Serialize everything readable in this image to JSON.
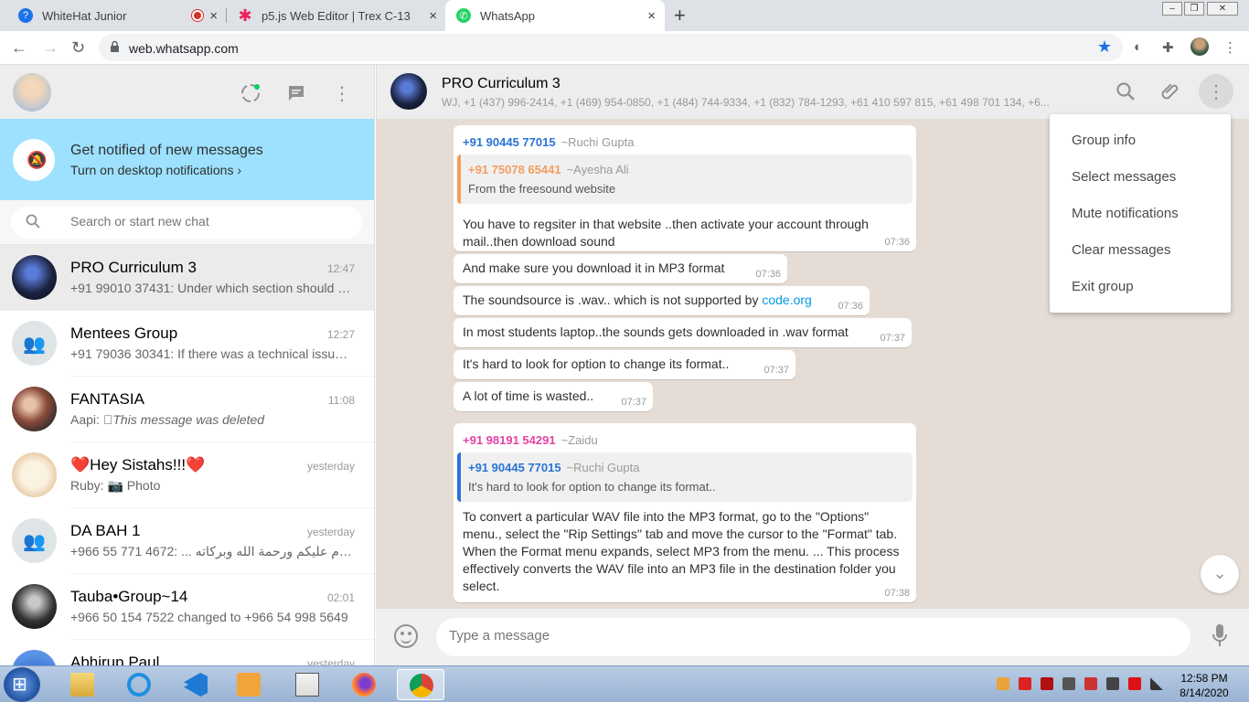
{
  "browser": {
    "tabs": [
      {
        "title": "WhiteHat Junior",
        "close": "×"
      },
      {
        "title": "p5.js Web Editor | Trex C-13",
        "close": "×"
      },
      {
        "title": "WhatsApp",
        "close": "×"
      }
    ],
    "new_tab": "+",
    "url": "web.whatsapp.com",
    "window_controls": [
      "–",
      "❐",
      "✕"
    ]
  },
  "sidebar": {
    "notification": {
      "title": "Get notified of new messages",
      "subtitle": "Turn on desktop notifications ›"
    },
    "search_placeholder": "Search or start new chat",
    "chats": [
      {
        "name": "PRO Curriculum 3",
        "time": "12:47",
        "last": "+91 99010 37431: Under which section should we ...",
        "selected": true
      },
      {
        "name": "Mentees Group",
        "time": "12:27",
        "last": "+91 79036 30341: If there was a technical issue f...",
        "selected": false
      },
      {
        "name": "FANTASIA",
        "time": "11:08",
        "last_prefix": "Aapi: ",
        "last": "This message was deleted",
        "selected": false
      },
      {
        "name": "❤️Hey Sistahs!!!❤️",
        "time": "yesterday",
        "last_prefix": "Ruby: ",
        "last": "Photo",
        "selected": false
      },
      {
        "name": "DA BAH 1",
        "time": "yesterday",
        "last": "+966 55 771 4672: ...     السلام عليكم ورحمة الله وبركاته.",
        "selected": false
      },
      {
        "name": "Tauba•Group~14",
        "time": "02:01",
        "last": "+966 50 154 7522 changed to +966 54 998 5649",
        "selected": false
      },
      {
        "name": "Abhirup Paul",
        "time": "yesterday",
        "last": "",
        "selected": false
      }
    ]
  },
  "conversation": {
    "title": "PRO Curriculum 3",
    "members": "WJ, +1 (437) 996-2414, +1 (469) 954-0850, +1 (484) 744-9334, +1 (832) 784-1293, +61 410 597 815, +61 498 701 134, +6...",
    "messages": [
      {
        "sender_phone": "+91 90445 77015",
        "sender_name": "~Ruchi Gupta",
        "quote_phone": "+91 75078 65441",
        "quote_name": "~Ayesha Ali",
        "quote_text": "From the freesound website",
        "text_lines": [
          "You have to regsiter in that website ..then activate your account through",
          "mail..then download sound"
        ],
        "time": "07:36"
      },
      {
        "text": "And make sure you download it in MP3 format",
        "time": "07:36"
      },
      {
        "text": "The soundsource is .wav.. which is not supported by ",
        "link": "code.org",
        "time": "07:36"
      },
      {
        "text": "In most students laptop..the sounds gets downloaded in .wav format",
        "time": "07:37"
      },
      {
        "text": "It's hard to look for option to change its format..",
        "time": "07:37"
      },
      {
        "text": "A lot of time is wasted..",
        "time": "07:37"
      },
      {
        "sender_phone": "+91 98191 54291",
        "sender_name": "~Zaidu",
        "quote_phone": "+91 90445 77015",
        "quote_name": "~Ruchi Gupta",
        "quote_text": "It's hard to look for option to change its format..",
        "text_lines": [
          "To convert a particular WAV file into the MP3 format, go to the \"Options\"",
          "menu., select the \"Rip Settings\" tab and move the cursor to the \"Format\" tab.",
          "When the Format menu expands, select MP3 from the menu. ... This process",
          "effectively converts the WAV file into an MP3 file in the destination folder you",
          "select."
        ],
        "time": "07:38"
      }
    ],
    "composer_placeholder": "Type a message"
  },
  "menu": {
    "items": [
      "Group info",
      "Select messages",
      "Mute notifications",
      "Clear messages",
      "Exit group"
    ]
  },
  "taskbar": {
    "time": "12:58 PM",
    "date": "8/14/2020"
  },
  "colors": {
    "accent_blue": "#1a73e8",
    "notif_bg": "#9de1fe",
    "chat_bg": "#e5ddd5",
    "sender_blue": "#2874d6",
    "sender_orange": "#f39e60",
    "sender_pink": "#e542a3",
    "link": "#039be5"
  }
}
